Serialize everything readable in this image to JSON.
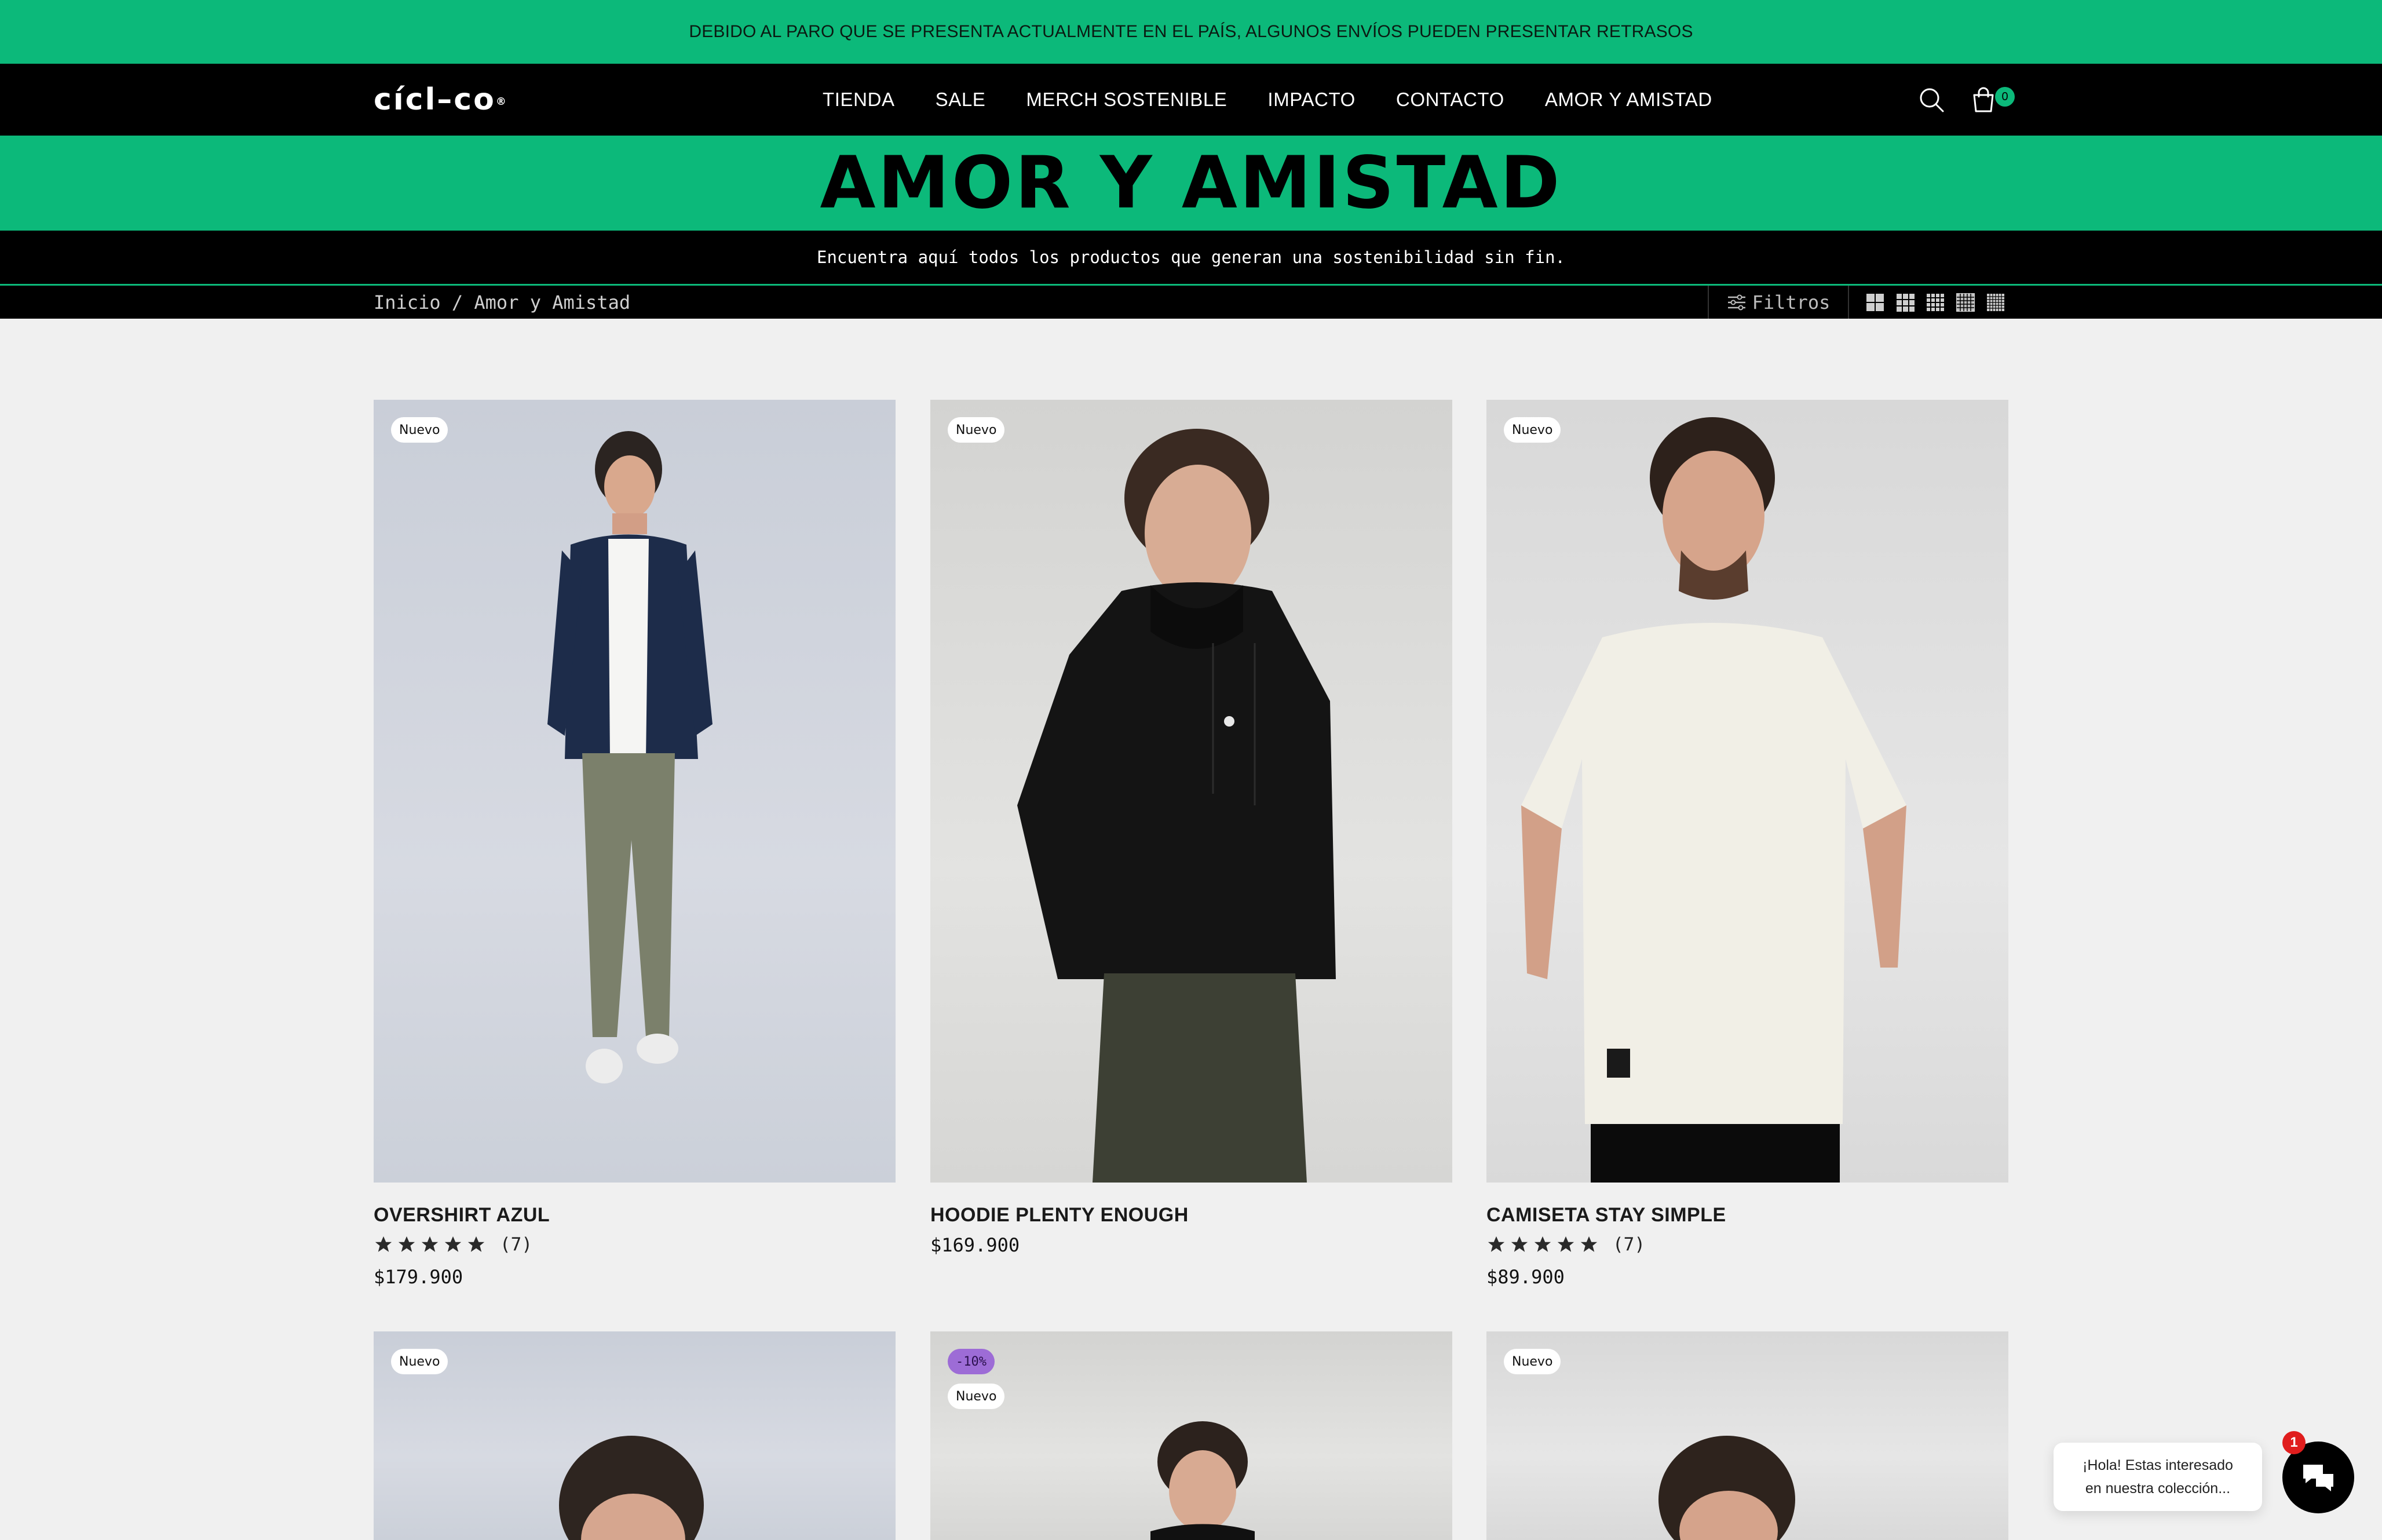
{
  "announcement": "DEBIDO AL PARO QUE SE PRESENTA ACTUALMENTE EN EL PAÍS, ALGUNOS ENVÍOS PUEDEN PRESENTAR RETRASOS",
  "brand": {
    "logo_text": "cícl–co",
    "reg_mark": "®"
  },
  "nav": [
    {
      "label": "TIENDA"
    },
    {
      "label": "SALE"
    },
    {
      "label": "MERCH SOSTENIBLE"
    },
    {
      "label": "IMPACTO"
    },
    {
      "label": "CONTACTO"
    },
    {
      "label": "AMOR Y AMISTAD"
    }
  ],
  "header": {
    "cart_count": "0",
    "icons": [
      "search-icon",
      "shopping-bag-icon"
    ]
  },
  "hero": {
    "title": "AMOR Y AMISTAD",
    "subtitle": "Encuentra aquí todos los productos que generan una sostenibilidad sin fin."
  },
  "toolbar": {
    "breadcrumb": "Inicio / Amor y Amistad",
    "filters_label": "Filtros"
  },
  "products": [
    {
      "title": "OVERSHIRT AZUL",
      "badge": "Nuevo",
      "reviews": "(7)",
      "price": "$179.900"
    },
    {
      "title": "HOODIE PLENTY ENOUGH",
      "badge": "Nuevo",
      "reviews": "",
      "price": "$169.900"
    },
    {
      "title": "CAMISETA STAY SIMPLE",
      "badge": "Nuevo",
      "reviews": "(7)",
      "price": "$89.900"
    },
    {
      "title": "",
      "badge": "Nuevo",
      "reviews": "",
      "price": ""
    },
    {
      "title": "",
      "badge": "Nuevo",
      "sale_badge": "-10%",
      "reviews": "",
      "price": ""
    },
    {
      "title": "",
      "badge": "Nuevo",
      "reviews": "",
      "price": ""
    }
  ],
  "chat": {
    "line1": "¡Hola! Estas interesado",
    "line2": "en nuestra colección...",
    "unread": "1"
  },
  "colors": {
    "accent": "#0cb97a",
    "header_bg": "#000000",
    "page_bg": "#f0f0f0",
    "sale_badge": "#9d6cd6"
  }
}
